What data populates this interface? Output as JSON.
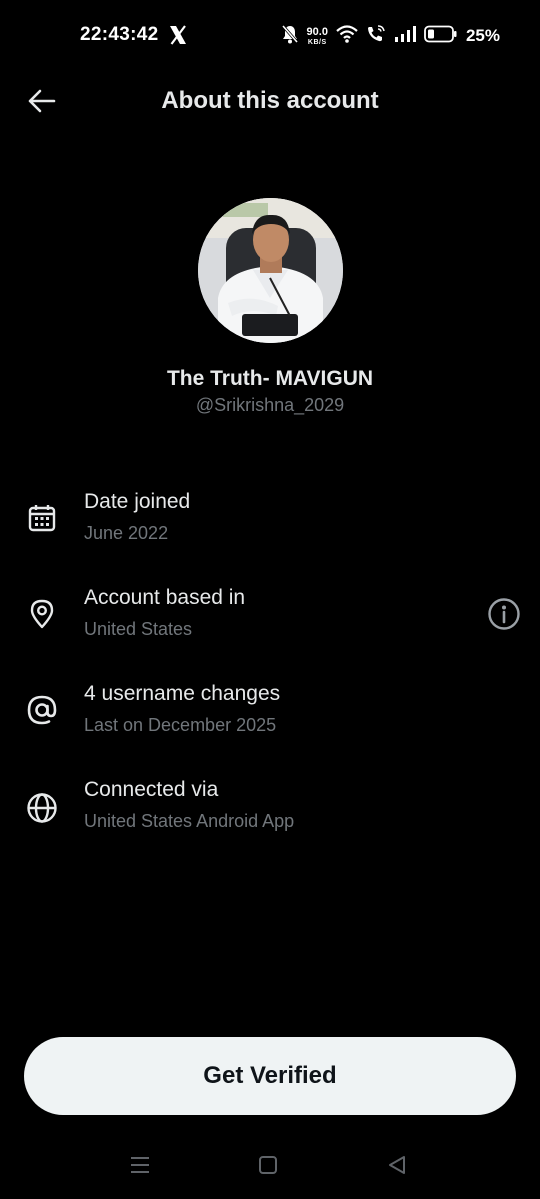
{
  "status_bar": {
    "time": "22:43:42",
    "net_speed_value": "90.0",
    "net_speed_unit": "KB/S",
    "battery_percent": "25%",
    "icons": [
      "x-logo-icon",
      "mute-icon",
      "wifi-icon",
      "wifi-calling-icon",
      "signal-icon",
      "battery-icon"
    ]
  },
  "header": {
    "title": "About this account"
  },
  "profile": {
    "display_name": "The Truth- MAVIGUN",
    "handle": "@Srikrishna_2029"
  },
  "info": [
    {
      "icon": "calendar-icon",
      "title": "Date joined",
      "subtitle": "June 2022"
    },
    {
      "icon": "location-pin-icon",
      "title": "Account based in",
      "subtitle": "United States",
      "action_icon": "info-icon"
    },
    {
      "icon": "at-sign-icon",
      "title": "4 username changes",
      "subtitle": "Last on December 2025"
    },
    {
      "icon": "globe-icon",
      "title": "Connected via",
      "subtitle": "United States Android App"
    }
  ],
  "verify_button": {
    "label": "Get Verified"
  },
  "nav": [
    "menu-icon",
    "home-square-icon",
    "back-triangle-icon"
  ],
  "colors": {
    "background": "#000000",
    "primary_text": "#e7e9ea",
    "secondary_text": "#71767b",
    "button_bg": "#eff3f4",
    "button_text": "#0f1419"
  }
}
